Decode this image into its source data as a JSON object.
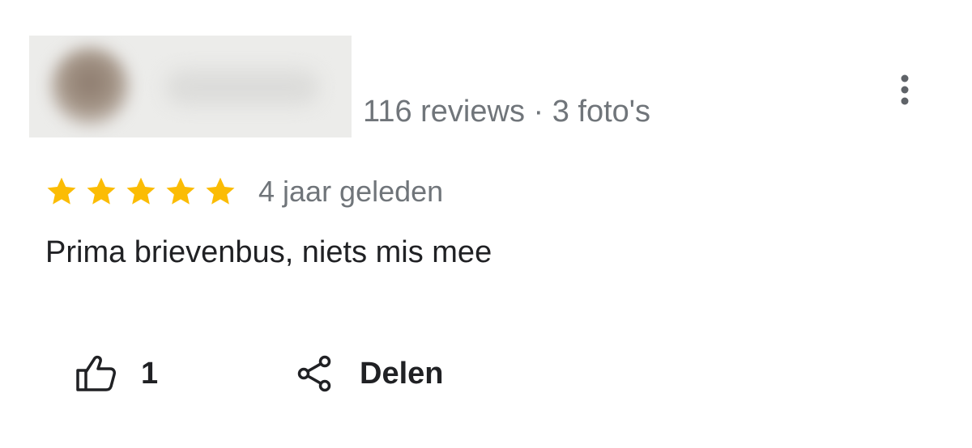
{
  "review": {
    "reviewer_meta": "116 reviews · 3 foto's",
    "rating": 5,
    "rating_max": 5,
    "time_ago": "4 jaar geleden",
    "text": "Prima brievenbus, niets mis mee"
  },
  "actions": {
    "like_count": "1",
    "share_label": "Delen"
  },
  "icons": {
    "more": "more-vert-icon",
    "like": "thumb-up-icon",
    "share": "share-icon",
    "star": "star-icon"
  },
  "colors": {
    "star": "#FBBC04",
    "meta_text": "#70757A",
    "body_text": "#202124"
  }
}
